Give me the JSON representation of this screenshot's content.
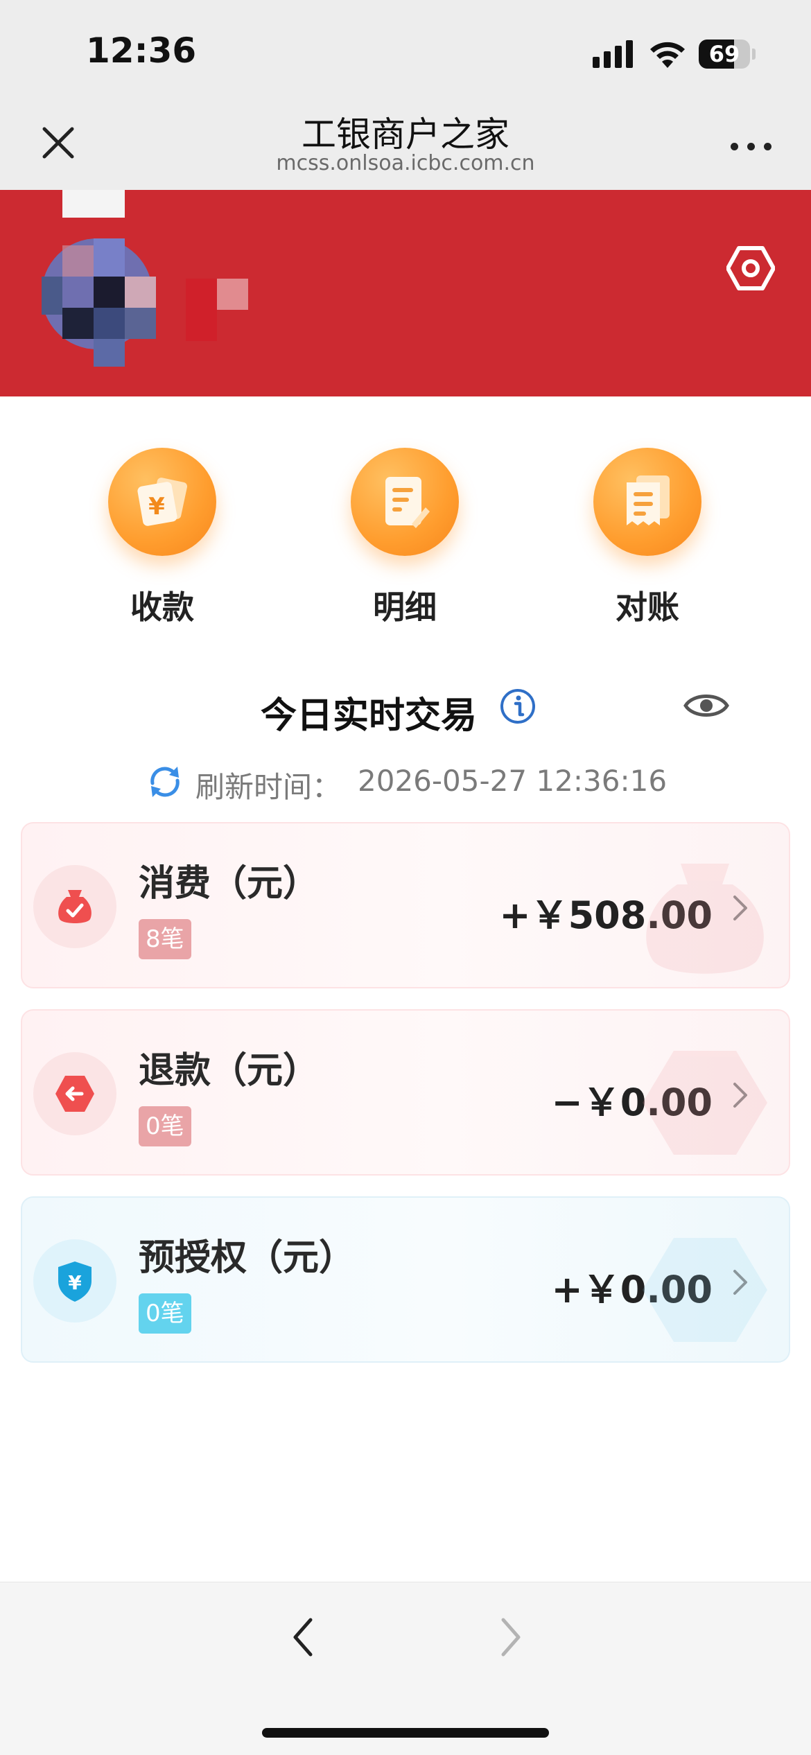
{
  "status_bar": {
    "time": "12:36",
    "battery": "69",
    "battery_level": 0.69
  },
  "title_bar": {
    "title": "工银商户之家",
    "url": "mcss.onlsoa.icbc.com.cn"
  },
  "quick_actions": [
    {
      "label": "收款",
      "icon": "receive-payment-icon"
    },
    {
      "label": "明细",
      "icon": "details-icon"
    },
    {
      "label": "对账",
      "icon": "reconcile-icon"
    }
  ],
  "today": {
    "title": "今日实时交易",
    "refresh_label": "刷新时间：",
    "refresh_time": "2026-05-27 12:36:16"
  },
  "cards": [
    {
      "title": "消费（元）",
      "count": "8笔",
      "amount": "+￥508.00",
      "theme": "red",
      "icon": "money-bag-icon"
    },
    {
      "title": "退款（元）",
      "count": "0笔",
      "amount": "−￥0.00",
      "theme": "red",
      "icon": "refund-icon"
    },
    {
      "title": "预授权（元）",
      "count": "0笔",
      "amount": "+￥0.00",
      "theme": "blue",
      "icon": "shield-yen-icon"
    }
  ],
  "colors": {
    "banner": "#cc2a31",
    "action_orange": "#ff9d2e",
    "info_blue": "#2f6fc7",
    "refresh_blue": "#3a8ee6",
    "red_badge": "#e9a4a7",
    "blue_badge": "#63d3ee"
  }
}
